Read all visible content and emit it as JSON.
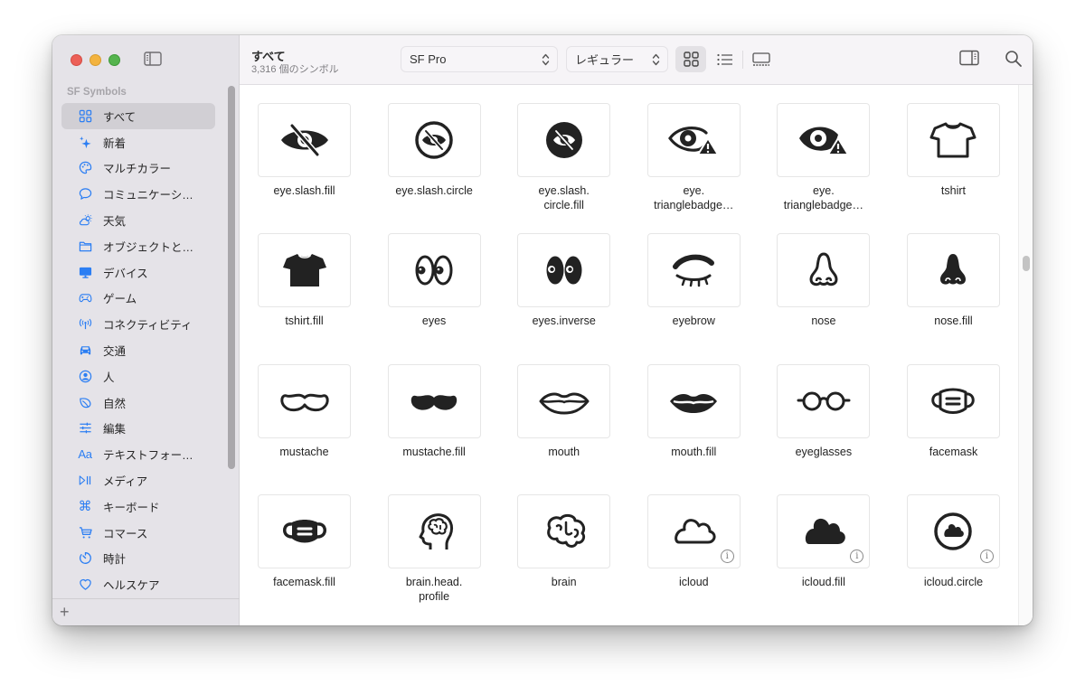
{
  "app": {
    "sidebar_heading": "SF Symbols",
    "add_label": "+"
  },
  "sidebar": {
    "items": [
      {
        "label": "すべて",
        "icon": "square-grid-icon",
        "selected": true
      },
      {
        "label": "新着",
        "icon": "sparkles-icon"
      },
      {
        "label": "マルチカラー",
        "icon": "paintpalette-icon"
      },
      {
        "label": "コミュニケーシ…",
        "icon": "message-bubble-icon"
      },
      {
        "label": "天気",
        "icon": "cloud-sun-icon"
      },
      {
        "label": "オブジェクトと…",
        "icon": "folder-icon"
      },
      {
        "label": "デバイス",
        "icon": "desktop-computer-icon"
      },
      {
        "label": "ゲーム",
        "icon": "gamecontroller-icon"
      },
      {
        "label": "コネクティビティ",
        "icon": "antenna-radiowaves-icon"
      },
      {
        "label": "交通",
        "icon": "car-icon"
      },
      {
        "label": "人",
        "icon": "person-circle-icon"
      },
      {
        "label": "自然",
        "icon": "leaf-icon"
      },
      {
        "label": "編集",
        "icon": "slider-horizontal-icon"
      },
      {
        "label": "テキストフォー…",
        "icon": "textformat-icon"
      },
      {
        "label": "メディア",
        "icon": "playpause-icon"
      },
      {
        "label": "キーボード",
        "icon": "command-icon"
      },
      {
        "label": "コマース",
        "icon": "cart-icon"
      },
      {
        "label": "時計",
        "icon": "timer-icon"
      },
      {
        "label": "ヘルスケア",
        "icon": "heart-icon"
      }
    ]
  },
  "toolbar": {
    "title": "すべて",
    "subtitle": "3,316 個のシンボル",
    "font_select": "SF Pro",
    "weight_select": "レギュラー",
    "view_modes": [
      "grid",
      "list",
      "gallery"
    ],
    "active_view": "grid"
  },
  "symbols": [
    {
      "name": "eye.slash.fill",
      "icon": "eye-slash-fill-icon"
    },
    {
      "name": "eye.slash.circle",
      "icon": "eye-slash-circle-icon"
    },
    {
      "name": "eye.slash.\ncircle.fill",
      "icon": "eye-slash-circle-fill-icon"
    },
    {
      "name": "eye.\ntrianglebadge…",
      "icon": "eye-trianglebadge-icon"
    },
    {
      "name": "eye.\ntrianglebadge…",
      "icon": "eye-fill-trianglebadge-icon"
    },
    {
      "name": "tshirt",
      "icon": "tshirt-icon"
    },
    {
      "name": "tshirt.fill",
      "icon": "tshirt-fill-icon"
    },
    {
      "name": "eyes",
      "icon": "eyes-icon"
    },
    {
      "name": "eyes.inverse",
      "icon": "eyes-inverse-icon"
    },
    {
      "name": "eyebrow",
      "icon": "eyebrow-icon"
    },
    {
      "name": "nose",
      "icon": "nose-icon"
    },
    {
      "name": "nose.fill",
      "icon": "nose-fill-icon"
    },
    {
      "name": "mustache",
      "icon": "mustache-icon"
    },
    {
      "name": "mustache.fill",
      "icon": "mustache-fill-icon"
    },
    {
      "name": "mouth",
      "icon": "mouth-icon"
    },
    {
      "name": "mouth.fill",
      "icon": "mouth-fill-icon"
    },
    {
      "name": "eyeglasses",
      "icon": "eyeglasses-icon"
    },
    {
      "name": "facemask",
      "icon": "facemask-icon"
    },
    {
      "name": "facemask.fill",
      "icon": "facemask-fill-icon"
    },
    {
      "name": "brain.head.\nprofile",
      "icon": "brain-head-profile-icon"
    },
    {
      "name": "brain",
      "icon": "brain-icon"
    },
    {
      "name": "icloud",
      "icon": "icloud-icon",
      "info": true
    },
    {
      "name": "icloud.fill",
      "icon": "icloud-fill-icon",
      "info": true
    },
    {
      "name": "icloud.circle",
      "icon": "icloud-circle-icon",
      "info": true
    }
  ],
  "info_glyph": "i",
  "colors": {
    "accent": "#2b7ef3",
    "sidebar_bg": "#e5e3e8",
    "sidebar_selected": "#d1cfd4",
    "glyph": "#222222"
  }
}
